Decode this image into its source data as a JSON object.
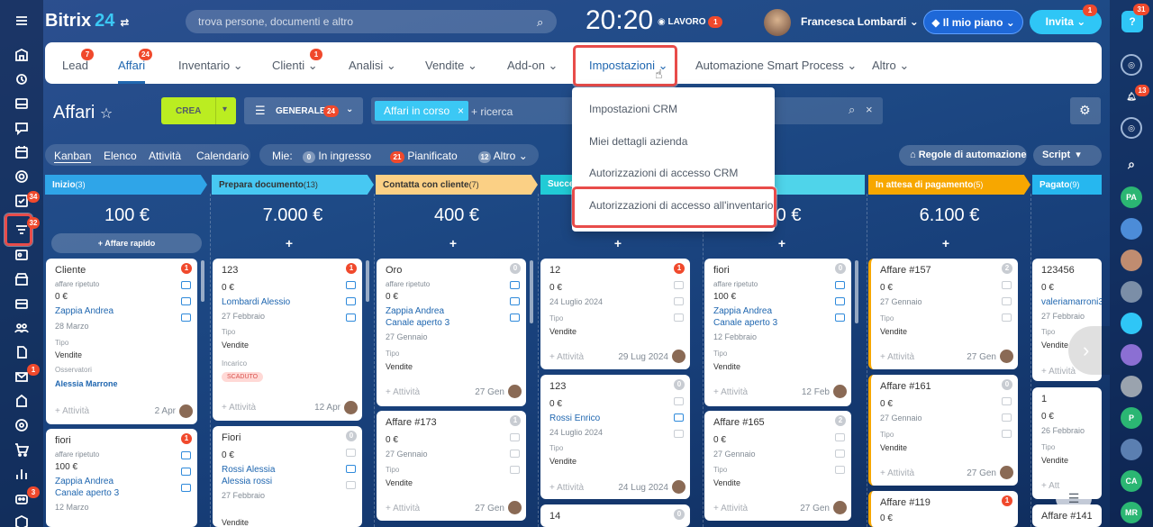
{
  "header": {
    "logo_text": "Bitrix",
    "logo_num": "24",
    "search_placeholder": "trova persone, documenti e altro",
    "clock": "20:20",
    "work_status": "LAVORO",
    "work_badge": "1",
    "user_name": "Francesca Lombardi",
    "plan_label": "Il mio piano",
    "invite_label": "Invita",
    "invite_badge": "1",
    "help_badge": "31"
  },
  "sidebar_badges": {
    "tasks": "34",
    "crm": "32",
    "chat": "1",
    "mail": "1",
    "robot": "3"
  },
  "rsidebar": {
    "notif_badge": "13",
    "avatars": [
      "PA",
      "P",
      "CA",
      "MR"
    ]
  },
  "nav": {
    "items": [
      {
        "label": "Lead",
        "badge": "7"
      },
      {
        "label": "Affari",
        "badge": "24"
      },
      {
        "label": "Inventario"
      },
      {
        "label": "Clienti",
        "badge": "1"
      },
      {
        "label": "Analisi"
      },
      {
        "label": "Vendite"
      },
      {
        "label": "Add-on"
      },
      {
        "label": "Impostazioni"
      },
      {
        "label": "Automazione Smart Process"
      },
      {
        "label": "Altro"
      }
    ]
  },
  "dropdown": {
    "items": [
      "Impostazioni CRM",
      "Miei dettagli azienda",
      "Autorizzazioni di accesso CRM",
      "Autorizzazioni di accesso all'inventario"
    ]
  },
  "toolbar": {
    "title": "Affari",
    "crea": "CREA",
    "generale": "GENERALE",
    "generale_badge": "24",
    "filter_chip": "Affari in corso",
    "filter_add": "+ ricerca"
  },
  "views": {
    "kanban": "Kanban",
    "elenco": "Elenco",
    "attivita": "Attività",
    "calendario": "Calendario"
  },
  "mie": {
    "label": "Mie:",
    "in_ingresso": "In ingresso",
    "in_ingresso_n": "0",
    "pianificato": "Pianificato",
    "pianificato_n": "21",
    "altro": "Altro",
    "altro_n": "12"
  },
  "regole": "Regole di automazione",
  "script": "Script",
  "columns": [
    {
      "name": "Inizio",
      "count": "(3)",
      "sum": "100 €",
      "color": "#2fa5e8"
    },
    {
      "name": "Prepara documento",
      "count": "(13)",
      "sum": "7.000 €",
      "color": "#47c8f2"
    },
    {
      "name": "Contatta con cliente",
      "count": "(7)",
      "sum": "400 €",
      "color": "#fbd085"
    },
    {
      "name": "Succes",
      "count": "",
      "sum": "",
      "color": "#21cbd6"
    },
    {
      "name": "",
      "count": "",
      "sum": "00 €",
      "color": "#4fd4ea"
    },
    {
      "name": "In attesa di pagamento",
      "count": "(5)",
      "sum": "6.100 €",
      "color": "#f7a700"
    },
    {
      "name": "Pagato",
      "count": "(9)",
      "sum": "",
      "color": "#26b7ef"
    }
  ],
  "quick_deal": "Affare rapido",
  "cards": {
    "c1": {
      "title": "Cliente",
      "badge": "1",
      "sub": "affare ripetuto",
      "amount": "0 €",
      "contact": "Zappia Andrea",
      "date": "28 Marzo",
      "tipo_l": "Tipo",
      "tipo": "Vendite",
      "obs_l": "Osservatori",
      "obs": "Alessia Marrone",
      "act": "+ Attività",
      "dt": "2 Apr"
    },
    "c2": {
      "title": "fiori",
      "badge": "1",
      "sub": "affare ripetuto",
      "amount": "100 €",
      "contact": "Zappia Andrea",
      "contact2": "Canale aperto 3",
      "date": "12 Marzo"
    },
    "c3": {
      "title": "123",
      "badge": "1",
      "amount": "0 €",
      "contact": "Lombardi Alessio",
      "date": "27 Febbraio",
      "tipo_l": "Tipo",
      "tipo": "Vendite",
      "inc_l": "Incarico",
      "inc": "SCADUTO",
      "act": "+ Attività",
      "dt": "12 Apr"
    },
    "c4": {
      "title": "Fiori",
      "badge": "0",
      "amount": "0 €",
      "contact": "Rossi Alessia",
      "contact2": "Alessia rossi",
      "date": "27 Febbraio",
      "tipo": "Vendite"
    },
    "c5": {
      "title": "Oro",
      "badge": "0",
      "sub": "affare ripetuto",
      "amount": "0 €",
      "contact": "Zappia Andrea",
      "contact2": "Canale aperto 3",
      "date": "27 Gennaio",
      "tipo_l": "Tipo",
      "tipo": "Vendite",
      "act": "+ Attività",
      "dt": "27 Gen"
    },
    "c6": {
      "title": "Affare #173",
      "badge": "1",
      "amount": "0 €",
      "date": "27 Gennaio",
      "tipo_l": "Tipo",
      "tipo": "Vendite",
      "act": "+ Attività",
      "dt": "27 Gen"
    },
    "c7": {
      "title": "12",
      "badge": "1",
      "amount": "0 €",
      "date": "24 Luglio 2024",
      "tipo_l": "Tipo",
      "tipo": "Vendite",
      "act": "+ Attività",
      "dt": "29 Lug 2024"
    },
    "c8": {
      "title": "123",
      "badge": "0",
      "amount": "0 €",
      "contact": "Rossi Enrico",
      "date": "24 Luglio 2024",
      "tipo_l": "Tipo",
      "tipo": "Vendite",
      "act": "+ Attività",
      "dt": "24 Lug 2024"
    },
    "c9": {
      "title": "14",
      "badge": "0"
    },
    "c10": {
      "title": "fiori",
      "badge": "0",
      "sub": "affare ripetuto",
      "amount": "100 €",
      "contact": "Zappia Andrea",
      "contact2": "Canale aperto 3",
      "date": "12 Febbraio",
      "tipo_l": "Tipo",
      "tipo": "Vendite",
      "act": "+ Attività",
      "dt": "12 Feb"
    },
    "c11": {
      "title": "Affare #165",
      "badge": "2",
      "amount": "0 €",
      "date": "27 Gennaio",
      "tipo_l": "Tipo",
      "tipo": "Vendite",
      "act": "+ Attività",
      "dt": "27 Gen"
    },
    "c12": {
      "title": "Affare #157",
      "badge": "2",
      "amount": "0 €",
      "date": "27 Gennaio",
      "tipo_l": "Tipo",
      "tipo": "Vendite",
      "act": "+ Attività",
      "dt": "27 Gen"
    },
    "c13": {
      "title": "Affare #161",
      "badge": "0",
      "amount": "0 €",
      "date": "27 Gennaio",
      "tipo_l": "Tipo",
      "tipo": "Vendite",
      "act": "+ Attività",
      "dt": "27 Gen"
    },
    "c14": {
      "title": "Affare #119",
      "badge": "1",
      "amount": "0 €"
    },
    "c15": {
      "title": "123456",
      "amount": "0 €",
      "contact": "valeriamarroni3",
      "date": "27 Febbraio",
      "tipo_l": "Tipo",
      "tipo": "Vendite",
      "act": "+ Attività"
    },
    "c16": {
      "title": "1",
      "amount": "0 €",
      "date": "26 Febbraio",
      "tipo_l": "Tipo",
      "tipo": "Vendite",
      "act": "+ Att"
    },
    "c17": {
      "title": "Affare #141"
    }
  }
}
